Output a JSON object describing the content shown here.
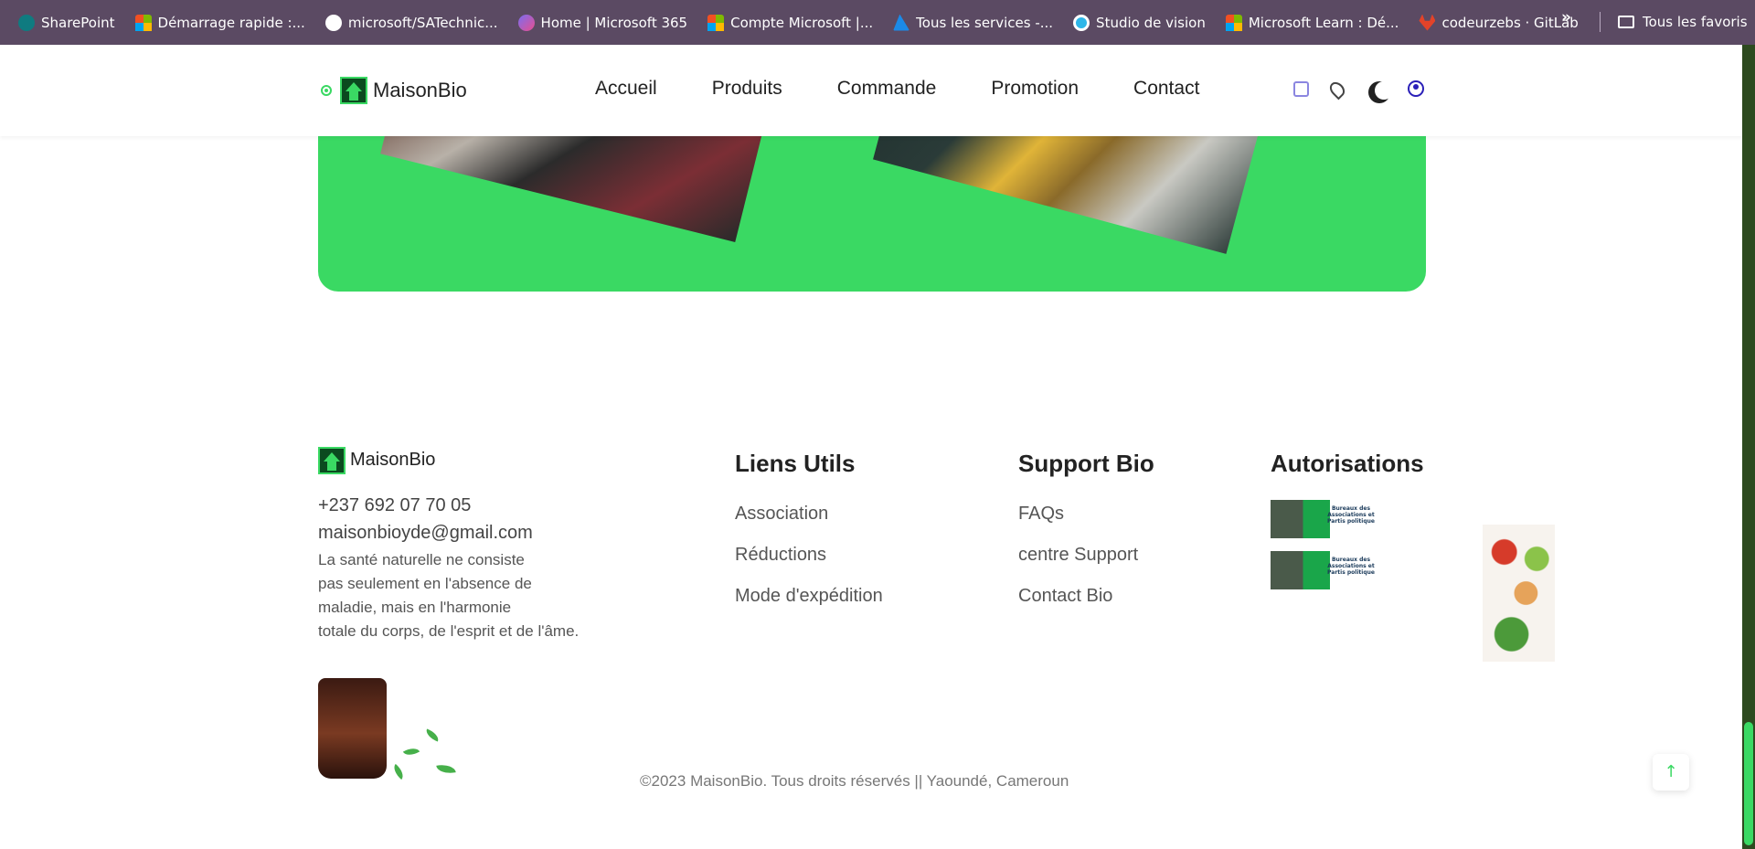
{
  "bookmarks": {
    "items": [
      {
        "label": "SharePoint",
        "icon": "sharepoint-icon"
      },
      {
        "label": "Démarrage rapide :...",
        "icon": "microsoft-icon"
      },
      {
        "label": "microsoft/SATechnic...",
        "icon": "github-icon"
      },
      {
        "label": "Home | Microsoft 365",
        "icon": "m365-icon"
      },
      {
        "label": "Compte Microsoft |...",
        "icon": "microsoft-icon"
      },
      {
        "label": "Tous les services -...",
        "icon": "azure-icon"
      },
      {
        "label": "Studio de vision",
        "icon": "vision-icon"
      },
      {
        "label": "Microsoft Learn : Dé...",
        "icon": "microsoft-icon"
      },
      {
        "label": "codeurzebs · GitLab",
        "icon": "gitlab-icon"
      }
    ],
    "more": "»",
    "all_favorites": "Tous les favoris"
  },
  "header": {
    "brand": "MaisonBio",
    "nav": [
      "Accueil",
      "Produits",
      "Commande",
      "Promotion",
      "Contact"
    ]
  },
  "footer": {
    "brand": "MaisonBio",
    "phone": "+237 692 07 70 05",
    "email": "maisonbioyde@gmail.com",
    "quote_lines": [
      "La santé naturelle ne consiste",
      "pas seulement en l'absence de",
      "maladie, mais en l'harmonie",
      "totale du corps, de l'esprit et de l'âme."
    ],
    "columns": {
      "links": {
        "title": "Liens Utils",
        "items": [
          "Association",
          "Réductions",
          "Mode d'expédition"
        ]
      },
      "support": {
        "title": "Support Bio",
        "items": [
          "FAQs",
          "centre Support",
          "Contact Bio"
        ]
      },
      "auth": {
        "title": "Autorisations",
        "badge_text": "Bureaux des Associations et Partis politique"
      }
    },
    "copyright": "©2023 MaisonBio. Tous droits réservés || Yaoundé, Cameroun",
    "back_to_top": "↑"
  },
  "colors": {
    "accent_green": "#3ad963",
    "bookmark_bar": "#5b4a63"
  }
}
